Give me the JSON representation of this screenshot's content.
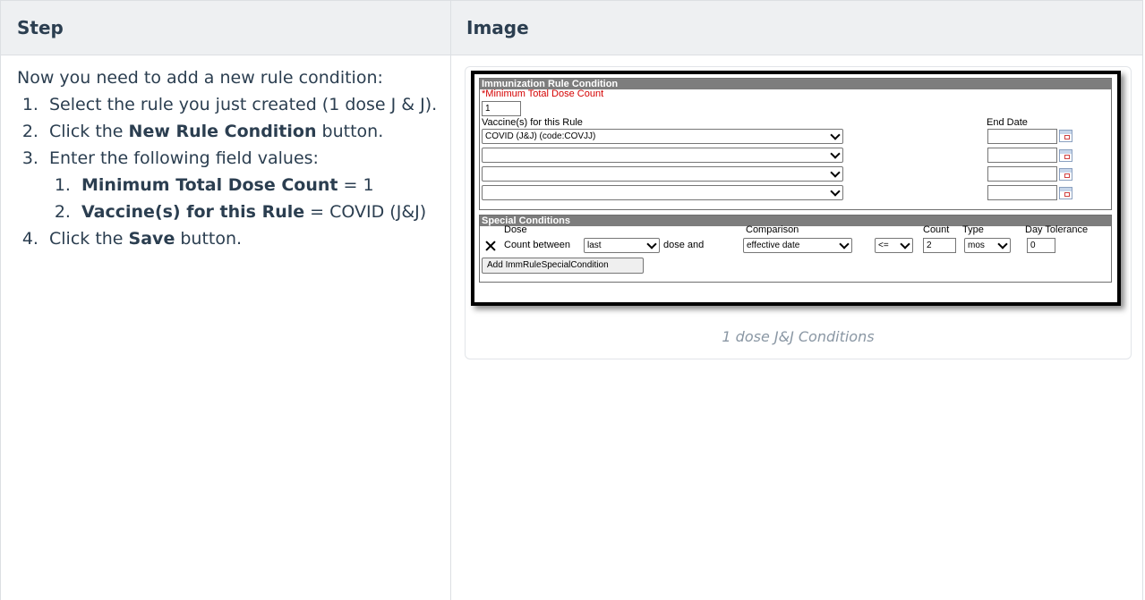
{
  "table": {
    "headers": {
      "step": "Step",
      "image": "Image"
    }
  },
  "step": {
    "intro": "Now you need to add a new rule condition:",
    "item1": "Select the rule you just created (1 dose J & J).",
    "item2_pre": "Click the ",
    "item2_bold": "New Rule Condition",
    "item2_post": " button.",
    "item3": "Enter the following field values:",
    "sub1_bold": "Minimum Total Dose Count",
    "sub1_post": " = 1",
    "sub2_bold": "Vaccine(s) for this Rule",
    "sub2_post": " = COVID (J&J)",
    "item4_pre": "Click the ",
    "item4_bold": "Save",
    "item4_post": " button."
  },
  "figure": {
    "caption": "1 dose J&J Conditions",
    "condition_panel": {
      "title": "Immunization Rule Condition",
      "min_dose_label": "*Minimum Total Dose Count",
      "min_dose_value": "1",
      "vaccine_label": "Vaccine(s) for this Rule",
      "end_date_label": "End Date",
      "vaccines": [
        "COVID (J&J) (code:COVJJ)",
        "",
        "",
        ""
      ]
    },
    "special_panel": {
      "title": "Special Conditions",
      "col_dose": "Dose",
      "col_comparison": "Comparison",
      "col_count": "Count",
      "col_type": "Type",
      "col_tolerance": "Day Tolerance",
      "count_between": "Count between",
      "dose_select": "last",
      "dose_and": "dose and",
      "comparison_select": "effective date",
      "operator_select": "<=",
      "count_value": "2",
      "type_select": "mos",
      "tolerance_value": "0",
      "add_button": "Add ImmRuleSpecialCondition"
    }
  }
}
